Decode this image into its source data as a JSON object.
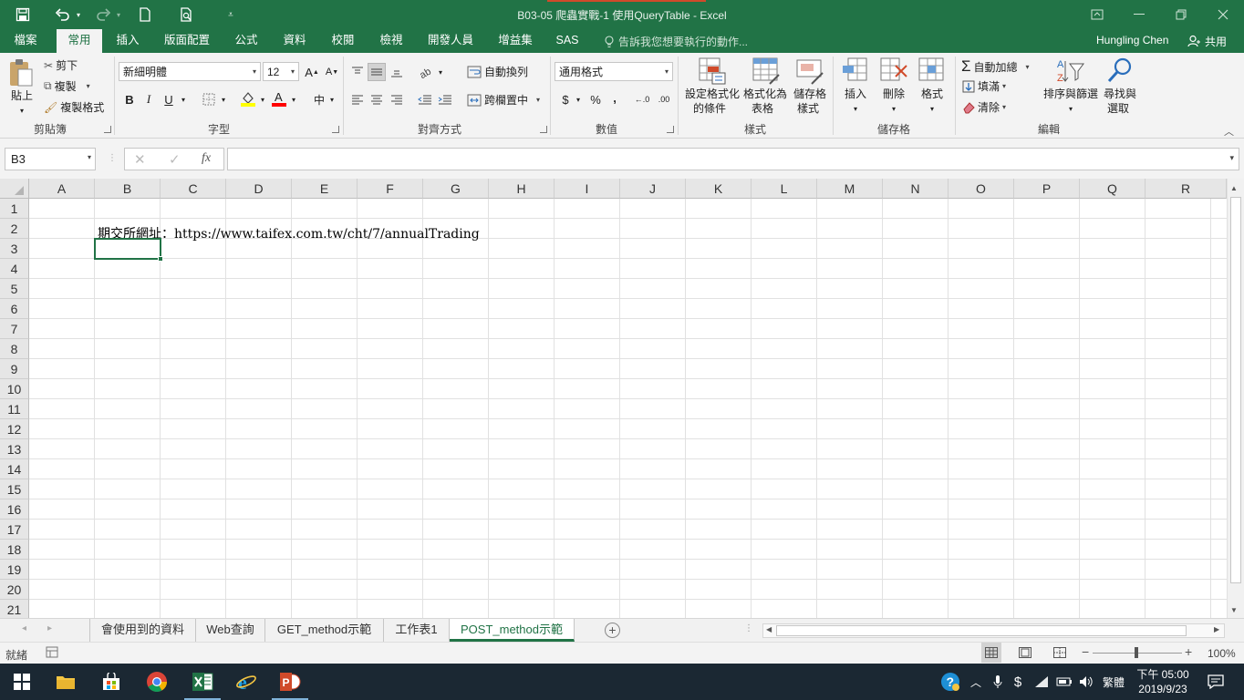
{
  "window": {
    "title": "B03-05 爬蟲實戰-1 使用QueryTable - Excel"
  },
  "quick_access": {
    "save_icon": "save-icon",
    "undo_icon": "undo-icon",
    "redo_icon": "redo-icon",
    "new_icon": "new-file-icon",
    "print_preview_icon": "print-preview-icon",
    "customize_icon": "customize-qat-icon"
  },
  "tabs": [
    {
      "label": "檔案"
    },
    {
      "label": "常用"
    },
    {
      "label": "插入"
    },
    {
      "label": "版面配置"
    },
    {
      "label": "公式"
    },
    {
      "label": "資料"
    },
    {
      "label": "校閱"
    },
    {
      "label": "檢視"
    },
    {
      "label": "開發人員"
    },
    {
      "label": "增益集"
    },
    {
      "label": "SAS"
    }
  ],
  "active_tab": "常用",
  "tell_me": "告訴我您想要執行的動作...",
  "user": "Hungling Chen",
  "share": "共用",
  "ribbon": {
    "clipboard": {
      "label": "剪貼簿",
      "paste": "貼上",
      "cut": "剪下",
      "copy": "複製",
      "format_painter": "複製格式"
    },
    "font": {
      "label": "字型",
      "font_name": "新細明體",
      "font_size": "12",
      "bold": "B",
      "italic": "I",
      "underline": "U",
      "fill_color": "#ffff00",
      "font_color": "#ff0000"
    },
    "alignment": {
      "label": "對齊方式",
      "wrap_text": "自動換列",
      "merge_center": "跨欄置中"
    },
    "number": {
      "label": "數值",
      "format": "通用格式",
      "currency": "$",
      "percent": "%",
      "comma": ","
    },
    "styles": {
      "label": "樣式",
      "conditional_l1": "設定格式化",
      "conditional_l2": "的條件",
      "as_table_l1": "格式化為",
      "as_table_l2": "表格",
      "cell_styles_l1": "儲存格",
      "cell_styles_l2": "樣式"
    },
    "cells": {
      "label": "儲存格",
      "insert": "插入",
      "delete": "刪除",
      "format": "格式"
    },
    "editing": {
      "label": "編輯",
      "autosum": "自動加總",
      "fill": "填滿",
      "clear": "清除",
      "sort_filter": "排序與篩選",
      "find_l1": "尋找與",
      "find_l2": "選取"
    }
  },
  "formula_bar": {
    "name_box": "B3",
    "formula": ""
  },
  "columns": [
    "A",
    "B",
    "C",
    "D",
    "E",
    "F",
    "G",
    "H",
    "I",
    "J",
    "K",
    "L",
    "M",
    "N",
    "O",
    "P",
    "Q",
    "R"
  ],
  "rows": [
    "1",
    "2",
    "3",
    "4",
    "5",
    "6",
    "7",
    "8",
    "9",
    "10",
    "11",
    "12",
    "13",
    "14",
    "15",
    "16",
    "17",
    "18",
    "19",
    "20",
    "21"
  ],
  "cells": {
    "B2": "期交所網址：https://www.taifex.com.tw/cht/7/annualTrading"
  },
  "sheets": [
    {
      "name": "會使用到的資料"
    },
    {
      "name": "Web查詢"
    },
    {
      "name": "GET_method示範"
    },
    {
      "name": "工作表1"
    },
    {
      "name": "POST_method示範"
    }
  ],
  "active_sheet": "POST_method示範",
  "status": {
    "mode": "就緒",
    "zoom": "100%"
  },
  "taskbar": {
    "time": "下午 05:00",
    "date": "2019/9/23",
    "ime": "繁體"
  },
  "colors": {
    "brand": "#217346",
    "accent": "#d04a2a"
  }
}
